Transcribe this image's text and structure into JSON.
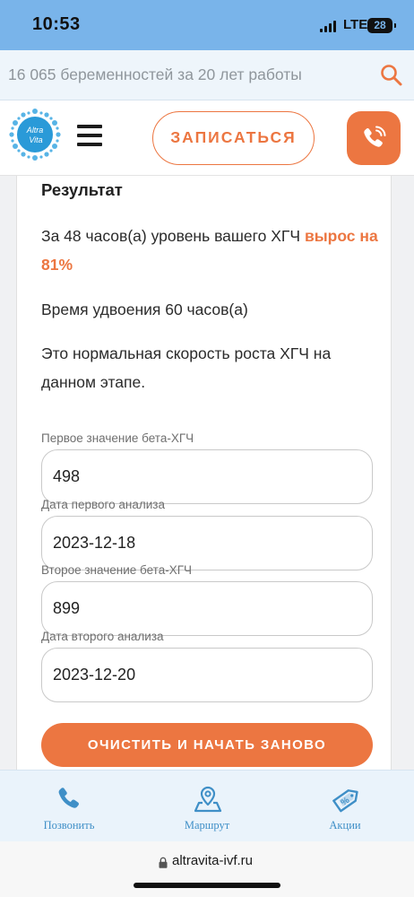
{
  "status_bar": {
    "time": "10:53",
    "network": "LTE",
    "battery": "28"
  },
  "promo": {
    "text": "16 065 беременностей за 20 лет работы"
  },
  "header": {
    "logo_text_top": "Altra",
    "logo_text_bottom": "Vita",
    "signup_label": "ЗАПИСАТЬСЯ",
    "brand_color": "#ec7641"
  },
  "result": {
    "title": "Результат",
    "growth_prefix": "За 48 часов(а) уровень вашего ХГЧ ",
    "growth_value": "вырос на 81%",
    "doubling": "Время удвоения 60 часов(а)",
    "verdict": "Это нормальная скорость роста ХГЧ на данном этапе."
  },
  "form": {
    "first_value_label": "Первое значение бета-ХГЧ",
    "first_value": "498",
    "first_date_label": "Дата первого анализа",
    "first_date": "2023-12-18",
    "second_value_label": "Второе значение бета-ХГЧ",
    "second_value": "899",
    "second_date_label": "Дата второго анализа",
    "second_date": "2023-12-20",
    "reset_label": "ОЧИСТИТЬ И НАЧАТЬ ЗАНОВО"
  },
  "bottom_nav": {
    "items": [
      {
        "label": "Позвонить",
        "icon": "phone-icon"
      },
      {
        "label": "Маршрут",
        "icon": "map-pin-icon"
      },
      {
        "label": "Акции",
        "icon": "discount-tag-icon"
      }
    ],
    "icon_color": "#3f8fc7"
  },
  "browser": {
    "url": "altravita-ivf.ru"
  }
}
